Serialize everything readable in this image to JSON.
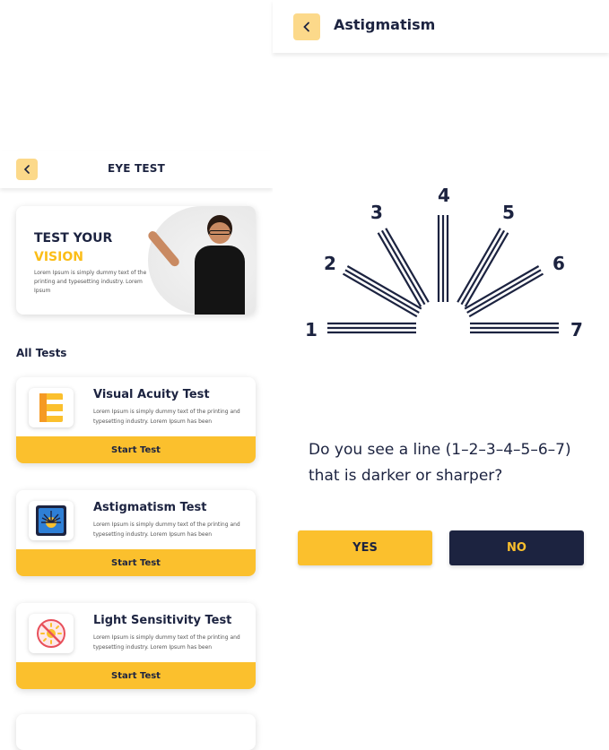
{
  "left_screen": {
    "header": {
      "title": "EYE TEST",
      "back_icon": "chevron-left-icon"
    },
    "banner": {
      "line1": "TEST YOUR",
      "line2": "VISION",
      "description": "Lorem Ipsum is simply dummy text of the printing and typesetting industry. Lorem Ipsum"
    },
    "section_title": "All Tests",
    "tests": [
      {
        "title": "Visual Acuity Test",
        "description": "Lorem Ipsum is simply dummy text of the printing and typesetting industry. Lorem Ipsum has been",
        "button": "Start Test",
        "icon": "letter-e-icon"
      },
      {
        "title": "Astigmatism Test",
        "description": "Lorem Ipsum is simply dummy text of the printing and typesetting industry. Lorem Ipsum has been",
        "button": "Start Test",
        "icon": "astigmatism-fan-icon"
      },
      {
        "title": "Light Sensitivity Test",
        "description": "Lorem Ipsum is simply dummy text of the printing and typesetting industry. Lorem Ipsum has been",
        "button": "Start Test",
        "icon": "no-sun-icon"
      }
    ]
  },
  "right_screen": {
    "header": {
      "title": "Astigmatism",
      "back_icon": "chevron-left-icon"
    },
    "dial_labels": [
      "1",
      "2",
      "3",
      "4",
      "5",
      "6",
      "7"
    ],
    "question": "Do you see a line (1–2–3–4–5–6–7) that is darker or sharper?",
    "yes_label": "YES",
    "no_label": "NO"
  },
  "colors": {
    "accent": "#fbc02d",
    "accent_light": "#fcd98a",
    "navy": "#1c2340"
  }
}
